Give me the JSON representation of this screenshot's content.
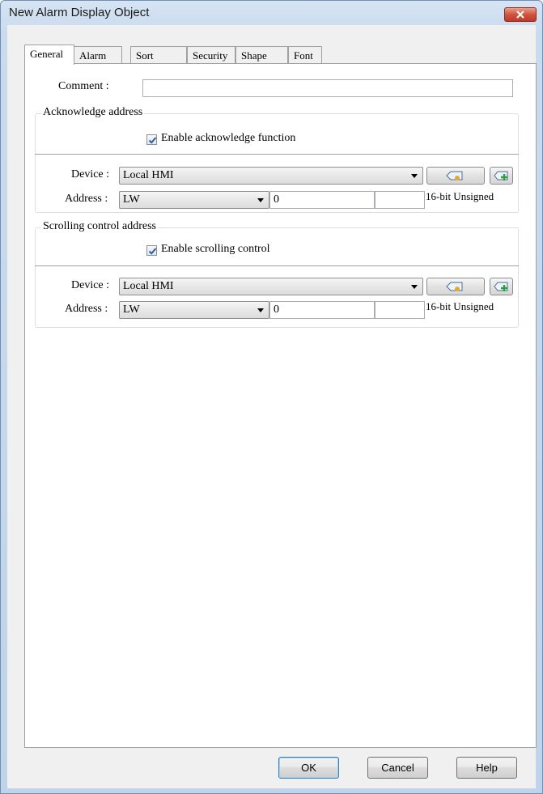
{
  "window": {
    "title": "New Alarm Display Object"
  },
  "tabs": [
    {
      "label": "General"
    },
    {
      "label": "Alarm"
    },
    {
      "label": "Sort"
    },
    {
      "label": "Security"
    },
    {
      "label": "Shape"
    },
    {
      "label": "Font"
    }
  ],
  "general": {
    "comment_label": "Comment :",
    "comment_value": ""
  },
  "acknowledge": {
    "group_title": "Acknowledge address",
    "enable_label": "Enable acknowledge function",
    "enabled": true,
    "device_label": "Device :",
    "device_value": "Local HMI",
    "address_label": "Address :",
    "address_type": "LW",
    "address_value": "0",
    "address_extra": "",
    "data_type": "16-bit Unsigned"
  },
  "scrolling": {
    "group_title": "Scrolling control address",
    "enable_label": "Enable scrolling control",
    "enabled": true,
    "device_label": "Device :",
    "device_value": "Local HMI",
    "address_label": "Address :",
    "address_type": "LW",
    "address_value": "0",
    "address_extra": "",
    "data_type": "16-bit Unsigned"
  },
  "buttons": {
    "ok": "OK",
    "cancel": "Cancel",
    "help": "Help"
  },
  "colors": {
    "title_bar": "#c9dbee",
    "close_button": "#c0392b",
    "panel": "#ffffff",
    "checkmark": "#2a5fa8"
  }
}
